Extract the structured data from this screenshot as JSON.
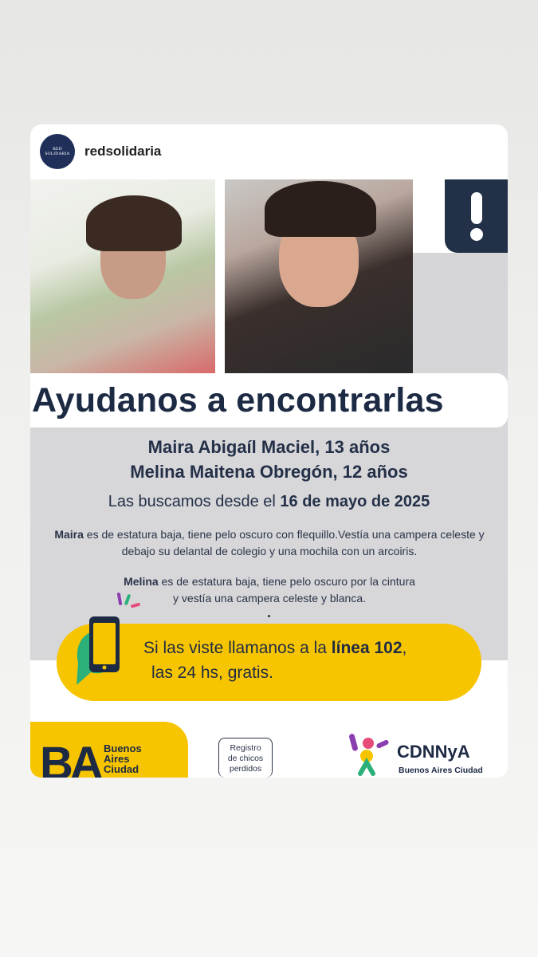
{
  "post": {
    "avatar_text": "RED SOLIDARIA",
    "username": "redsolidaria"
  },
  "poster": {
    "headline": "Ayudanos a encontrarlas",
    "names": [
      "Maira Abigaíl Maciel, 13 años",
      "Melina Maitena Obregón, 12 años"
    ],
    "since_prefix": "Las buscamos desde el ",
    "since_date": "16 de mayo de 2025",
    "desc1_name": "Maira",
    "desc1_text": " es de estatura baja, tiene  pelo oscuro con flequillo.Vestía una campera celeste y debajo su delantal de colegio y una mochila con un arcoiris.",
    "desc2_name": "Melina",
    "desc2_line1": " es de estatura baja, tiene pelo oscuro por la cintura",
    "desc2_line2": "y vestía una campera celeste y blanca.",
    "call_line1_prefix": "Si las viste llamanos a la ",
    "call_line1_bold": "línea 102",
    "call_line1_suffix": ",",
    "call_line2": "las 24 hs, gratis.",
    "ba_mark": "BA",
    "ba_words": [
      "Buenos",
      "Aires",
      "Ciudad"
    ],
    "registro": [
      "Registro",
      "de chicos",
      "perdidos"
    ],
    "cdnnya_title": "CDNNyA",
    "cdnnya_sub": "Buenos Aires Ciudad"
  },
  "icons": [
    "exclamation-icon",
    "phone-chat-icon",
    "sparkle-icon",
    "cdnnya-figure-icon"
  ],
  "colors": {
    "navy": "#1d2a44",
    "yellow": "#f7c500",
    "gray": "#d7d7d9"
  }
}
